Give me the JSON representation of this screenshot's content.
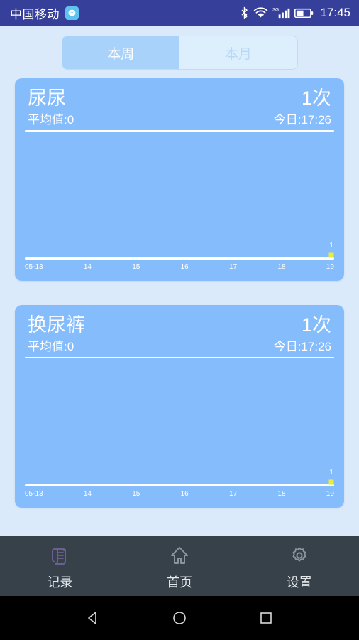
{
  "status_bar": {
    "carrier": "中国移动",
    "app_icon": "messenger-icon",
    "bluetooth_icon": "bluetooth-icon",
    "wifi_icon": "wifi-icon",
    "network_type": "3G",
    "signal_icon": "signal-bars-icon",
    "battery_icon": "battery-icon",
    "time": "17:45",
    "background_color": "#36409b"
  },
  "tabs": {
    "week_label": "本周",
    "month_label": "本月",
    "selected": "本周",
    "active_bg": "#a9d2fb",
    "inactive_bg": "#ddeefc"
  },
  "cards": [
    {
      "title": "尿尿",
      "average": "平均值:0",
      "count": "1次",
      "today": "今日:17:26",
      "chart_data": {
        "type": "line",
        "title": "尿尿",
        "categories": [
          "05-13",
          "14",
          "15",
          "16",
          "17",
          "18",
          "19"
        ],
        "values": [
          0,
          0,
          0,
          0,
          0,
          0,
          1
        ],
        "point_labels": [
          "",
          "",
          "",
          "",
          "",
          "",
          "1"
        ],
        "xlabel": "",
        "ylabel": "",
        "ylim": [
          0,
          1
        ],
        "grid": false,
        "legend": "none",
        "point_color": "#e8ec3c",
        "axis_color": "#ffffff"
      }
    },
    {
      "title": "换尿裤",
      "average": "平均值:0",
      "count": "1次",
      "today": "今日:17:26",
      "chart_data": {
        "type": "line",
        "title": "换尿裤",
        "categories": [
          "05-13",
          "14",
          "15",
          "16",
          "17",
          "18",
          "19"
        ],
        "values": [
          0,
          0,
          0,
          0,
          0,
          0,
          1
        ],
        "point_labels": [
          "",
          "",
          "",
          "",
          "",
          "",
          "1"
        ],
        "xlabel": "",
        "ylabel": "",
        "ylim": [
          0,
          1
        ],
        "grid": false,
        "legend": "none",
        "point_color": "#e8ec3c",
        "axis_color": "#ffffff"
      }
    }
  ],
  "tabbar": {
    "items": [
      {
        "label": "记录",
        "icon": "scroll-icon",
        "active": true
      },
      {
        "label": "首页",
        "icon": "home-icon",
        "active": false
      },
      {
        "label": "设置",
        "icon": "gear-icon",
        "active": false
      }
    ],
    "active_color": "#6e5f93",
    "inactive_color": "#8a949c",
    "background_color": "#36414a"
  },
  "android_nav": {
    "back_icon": "back-triangle-icon",
    "home_icon": "home-circle-icon",
    "recents_icon": "recents-square-icon"
  },
  "theme": {
    "page_bg": "#dbeafb",
    "card_bg": "#85bcfc"
  }
}
